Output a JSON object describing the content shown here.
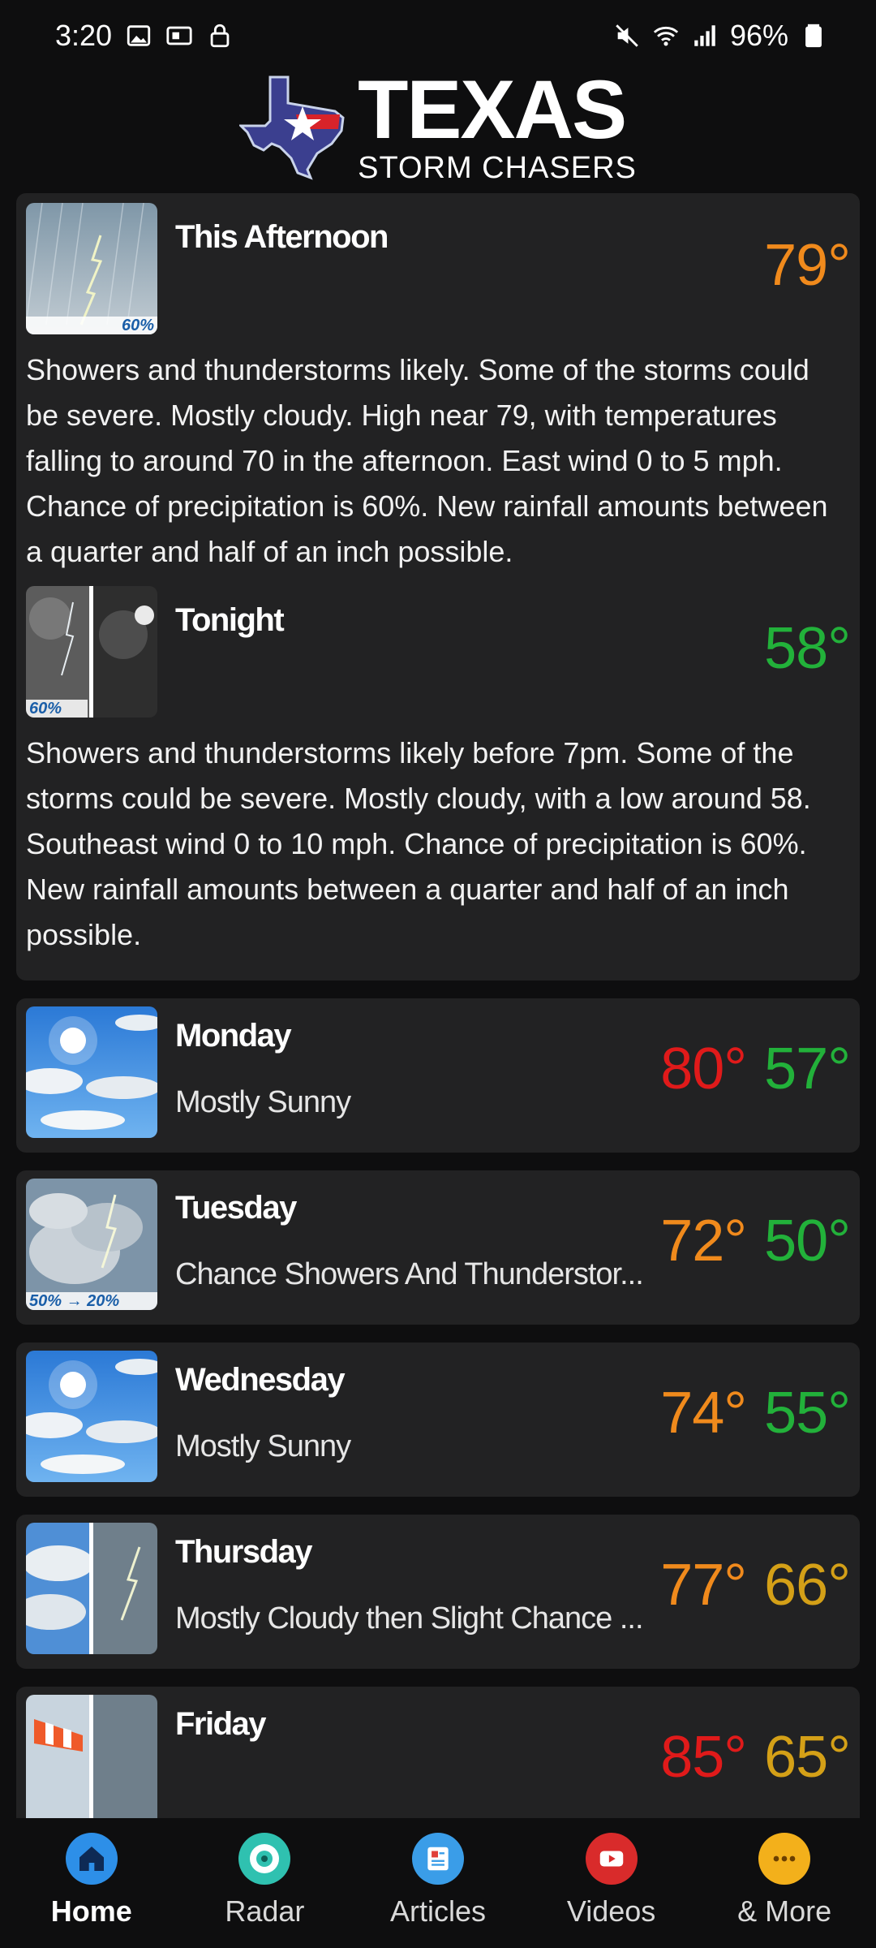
{
  "status_bar": {
    "time": "3:20",
    "battery": "96%",
    "icons_left": [
      "image-icon",
      "cast-icon",
      "lock-icon"
    ],
    "icons_right": [
      "mute-icon",
      "wifi-icon",
      "signal-icon",
      "battery-icon"
    ]
  },
  "header": {
    "logo_main": "TEXAS",
    "logo_sub": "STORM CHASERS"
  },
  "detailed": [
    {
      "name": "This Afternoon",
      "temp": "79°",
      "temp_color": "#f08a1c",
      "pop": "60%",
      "icon": "thunderstorm-icon",
      "description": "Showers and thunderstorms likely. Some of the storms could be severe. Mostly cloudy. High near 79, with temperatures falling to around 70 in the afternoon. East wind 0 to 5 mph. Chance of precipitation is 60%. New rainfall amounts between a quarter and half of an inch possible."
    },
    {
      "name": "Tonight",
      "temp": "58°",
      "temp_color": "#22b13a",
      "pop": "60%",
      "icon": "night-storm-icon",
      "description": "Showers and thunderstorms likely before 7pm. Some of the storms could be severe. Mostly cloudy, with a low around 58. Southeast wind 0 to 10 mph. Chance of precipitation is 60%. New rainfall amounts between a quarter and half of an inch possible."
    }
  ],
  "days": [
    {
      "name": "Monday",
      "short": "Mostly Sunny",
      "high": "80°",
      "low": "57°",
      "high_color": "#e01a1a",
      "low_color": "#22b13a",
      "icon": "sunny-clouds-icon",
      "pop": ""
    },
    {
      "name": "Tuesday",
      "short": "Chance Showers And Thunderstor...",
      "high": "72°",
      "low": "50°",
      "high_color": "#f08a1c",
      "low_color": "#22b13a",
      "icon": "thunderstorm-icon",
      "pop": "50% → 20%"
    },
    {
      "name": "Wednesday",
      "short": "Mostly Sunny",
      "high": "74°",
      "low": "55°",
      "high_color": "#f08a1c",
      "low_color": "#22b13a",
      "icon": "sunny-clouds-icon",
      "pop": ""
    },
    {
      "name": "Thursday",
      "short": "Mostly Cloudy then Slight Chance ...",
      "high": "77°",
      "low": "66°",
      "high_color": "#f08a1c",
      "low_color": "#d4a017",
      "icon": "cloudy-storm-icon",
      "pop": ""
    },
    {
      "name": "Friday",
      "short": "",
      "high": "85°",
      "low": "65°",
      "high_color": "#e01a1a",
      "low_color": "#d4a017",
      "icon": "windy-storm-icon",
      "pop": ""
    }
  ],
  "nav": [
    {
      "label": "Home",
      "icon": "home-icon",
      "color": "#2d8fe8",
      "active": true
    },
    {
      "label": "Radar",
      "icon": "radar-icon",
      "color": "#2fc1b0",
      "active": false
    },
    {
      "label": "Articles",
      "icon": "articles-icon",
      "color": "#3a9de8",
      "active": false
    },
    {
      "label": "Videos",
      "icon": "video-icon",
      "color": "#d92b2b",
      "active": false
    },
    {
      "label": "& More",
      "icon": "more-icon",
      "color": "#f3b01b",
      "active": false
    }
  ]
}
